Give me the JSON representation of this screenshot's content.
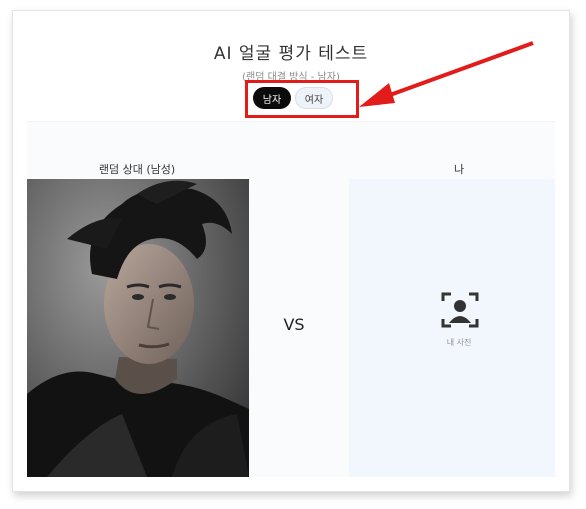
{
  "header": {
    "title": "AI 얼굴 평가 테스트",
    "subtitle": "(랜덤 대결 방식 - 남자)"
  },
  "gender_toggle": {
    "male_label": "남자",
    "female_label": "여자",
    "selected": "남자"
  },
  "columns": {
    "left_label": "랜덤 상대 (남성)",
    "right_label": "나"
  },
  "vs_label": "VS",
  "upload": {
    "label": "내 사진",
    "icon": "portrait-upload-icon"
  },
  "colors": {
    "highlight_box": "#e21b1b",
    "arrow": "#e21b1b",
    "selected_button": "#0b0b0b",
    "upload_bg": "#f2f7fd"
  }
}
